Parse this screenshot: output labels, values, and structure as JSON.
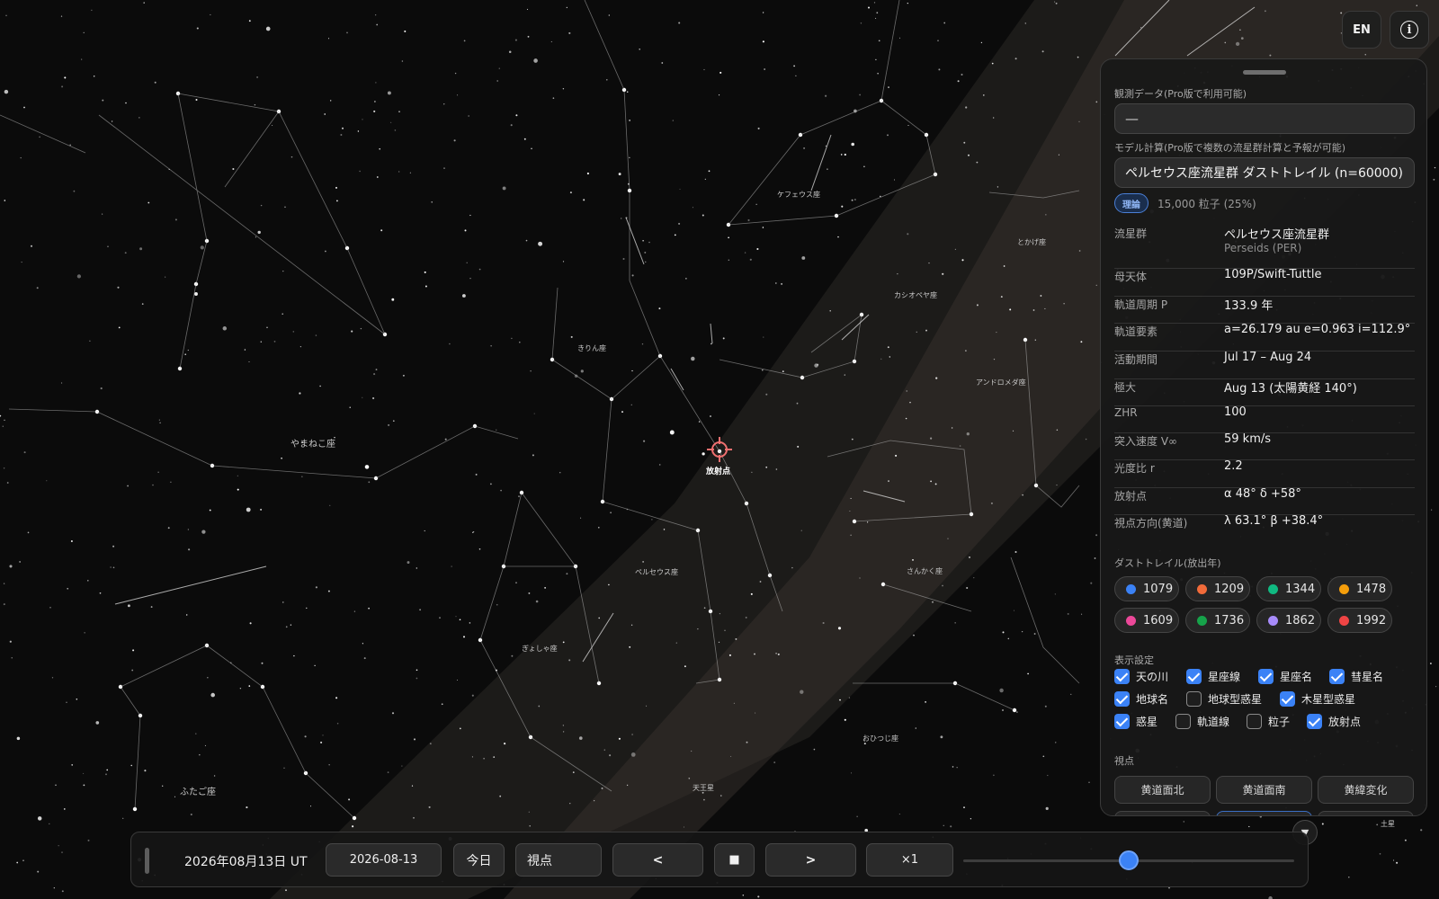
{
  "header": {
    "lang_button": "EN",
    "info_icon": "info-icon"
  },
  "sky": {
    "radiant_label": "放射点",
    "constellations": [
      "ケフェウス座",
      "とかげ座",
      "カシオペヤ座",
      "きりん座",
      "アンドロメダ座",
      "やまねこ座",
      "ペルセウス座",
      "さんかく座",
      "ぎょしゃ座",
      "おひつじ座",
      "ふたご座",
      "天王星",
      "土星"
    ]
  },
  "panel": {
    "observed_label": "観測データ(Pro版で利用可能)",
    "observed_value": "—",
    "model_label": "モデル計算(Pro版で複数の流星群計算と予報が可能)",
    "model_value": "ペルセウス座流星群 ダストトレイル (n=60000)",
    "tag": "理論",
    "particles": "15,000 粒子 (25%)",
    "props": [
      {
        "key": "流星群",
        "value": "ペルセウス座流星群",
        "sub": "Perseids (PER)"
      },
      {
        "key": "母天体",
        "value": "109P/Swift-Tuttle"
      },
      {
        "key": "軌道周期 P",
        "value": "133.9 年"
      },
      {
        "key": "軌道要素",
        "value": "a=26.179 au e=0.963 i=112.9°"
      },
      {
        "key": "活動期間",
        "value": "Jul 17 – Aug 24"
      },
      {
        "key": "極大",
        "value": "Aug 13 (太陽黄経 140°)"
      },
      {
        "key": "ZHR",
        "value": "100"
      },
      {
        "key": "突入速度 V∞",
        "value": "59 km/s"
      },
      {
        "key": "光度比 r",
        "value": "2.2"
      },
      {
        "key": "放射点",
        "value": "α 48° δ +58°"
      },
      {
        "key": "視点方向(黄道)",
        "value": "λ 63.1° β +38.4°"
      }
    ],
    "dust_label": "ダストトレイル(放出年)",
    "dust_trails": [
      {
        "year": "1079",
        "color": "#3b82f6"
      },
      {
        "year": "1209",
        "color": "#f26b3a"
      },
      {
        "year": "1344",
        "color": "#10b981"
      },
      {
        "year": "1478",
        "color": "#f59e0b"
      },
      {
        "year": "1609",
        "color": "#ec4899"
      },
      {
        "year": "1736",
        "color": "#16a34a"
      },
      {
        "year": "1862",
        "color": "#a78bfa"
      },
      {
        "year": "1992",
        "color": "#ef4444"
      }
    ],
    "display_label": "表示設定",
    "display": [
      {
        "label": "天の川",
        "checked": true
      },
      {
        "label": "星座線",
        "checked": true
      },
      {
        "label": "星座名",
        "checked": true
      },
      {
        "label": "彗星名",
        "checked": true
      },
      {
        "label": "地球名",
        "checked": true
      },
      {
        "label": "地球型惑星",
        "checked": false
      },
      {
        "label": "木星型惑星",
        "checked": true
      },
      {
        "label": "惑星",
        "checked": true
      },
      {
        "label": "軌道線",
        "checked": false
      },
      {
        "label": "粒子",
        "checked": false
      },
      {
        "label": "放射点",
        "checked": true
      }
    ],
    "view_label": "視点",
    "views": [
      "黄道面北",
      "黄道面南",
      "黄緯変化"
    ]
  },
  "bar": {
    "date_display": "2026年08月13日 UT",
    "date_input": "2026-08-13",
    "today": "今日",
    "viewpoint": "視点",
    "prev": "<",
    "stop": "■",
    "next": ">",
    "speed": "×1",
    "slider_fraction": 0.5,
    "collapse": "▼"
  },
  "colors": {
    "accent": "#3b82f6",
    "radiant": "#f07070"
  }
}
